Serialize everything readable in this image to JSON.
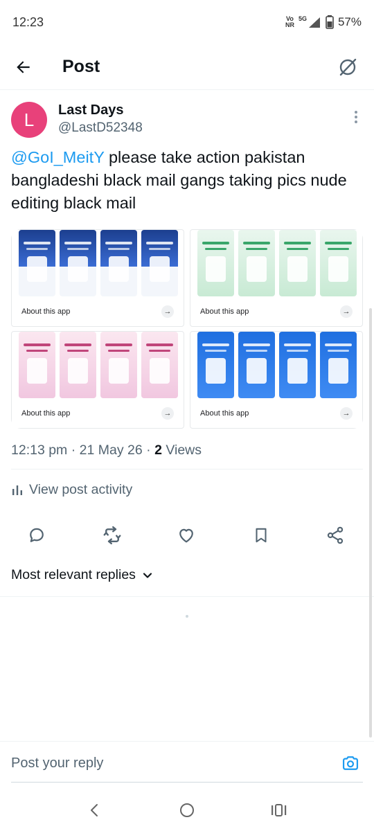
{
  "status_bar": {
    "time": "12:23",
    "volte": "Vo",
    "volte_sub": "NR",
    "network": "5G",
    "battery": "57%"
  },
  "header": {
    "title": "Post"
  },
  "post": {
    "author_initial": "L",
    "author_name": "Last Days",
    "author_handle": "@LastD52348",
    "mention": "@GoI_MeitY",
    "text": " please take action pakistan bangladeshi black mail gangs taking pics nude editing black mail",
    "media_tiles": [
      {
        "label": "About this app"
      },
      {
        "label": "About this app"
      },
      {
        "label": "About this app"
      },
      {
        "label": "About this app"
      }
    ],
    "time": "12:13 pm",
    "date": "21 May 26",
    "views_count": "2",
    "views_label": "Views",
    "activity_label": "View post activity"
  },
  "replies": {
    "sort_label": "Most relevant replies"
  },
  "composer": {
    "placeholder": "Post your reply"
  },
  "colors": {
    "accent": "#1d9bf0",
    "avatar": "#e8417a",
    "text_primary": "#0f1419",
    "text_secondary": "#536471"
  }
}
